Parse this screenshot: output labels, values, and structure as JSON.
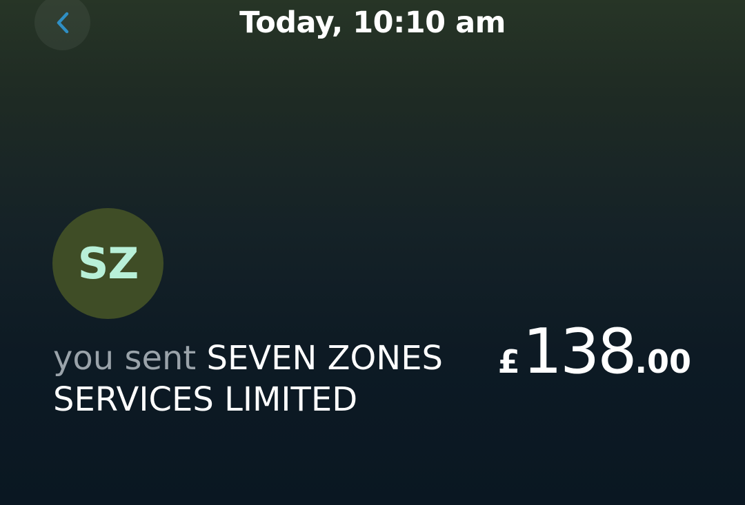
{
  "header": {
    "title": "Today, 10:10 am"
  },
  "avatar": {
    "initials": "SZ",
    "background": "#3f4d26",
    "text_color": "#b8f0d8"
  },
  "transaction": {
    "prefix": "you sent",
    "recipient": "SEVEN ZONES SERVICES LIMITED",
    "amount": {
      "currency": "£",
      "major": "138",
      "minor": ".00"
    }
  },
  "icons": {
    "back": "chevron-left-icon"
  },
  "colors": {
    "accent": "#2f8fc4"
  }
}
